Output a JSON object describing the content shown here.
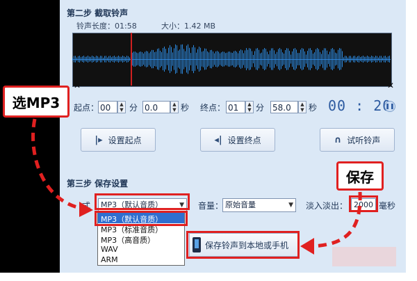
{
  "step2": {
    "title": "第二步  截取铃声",
    "length_label": "铃声长度：01:58",
    "size_label": "大小：1.42 MB"
  },
  "range": {
    "start_label": "起点：",
    "start_min": "00",
    "min_unit": "分",
    "start_sec": "0.0",
    "sec_unit": "秒",
    "end_label": "终点：",
    "end_min": "01",
    "end_sec": "58.0",
    "current_time": "00 : 20",
    "pause_icon": "pause-icon"
  },
  "buttons": {
    "set_start": "设置起点",
    "set_end": "设置终点",
    "preview": "试听铃声",
    "save": "保存铃声到本地或手机"
  },
  "step3": {
    "title": "第三步  保存设置",
    "format_label": "式",
    "format_value": "MP3（默认音质）",
    "volume_label": "音量：",
    "volume_value": "原始音量",
    "fade_label": "淡入淡出：",
    "fade_value": "2000",
    "fade_unit": "毫秒"
  },
  "format_options": [
    "MP3（默认音质）",
    "MP3（标准音质）",
    "MP3（高音质）",
    "WAV",
    "ARM"
  ],
  "annotations": {
    "select_mp3": "选MP3",
    "save": "保存"
  },
  "colors": {
    "annotation_red": "#e02020",
    "wave_blue": "#2c76c8",
    "panel_bg": "#dbe8f6"
  }
}
